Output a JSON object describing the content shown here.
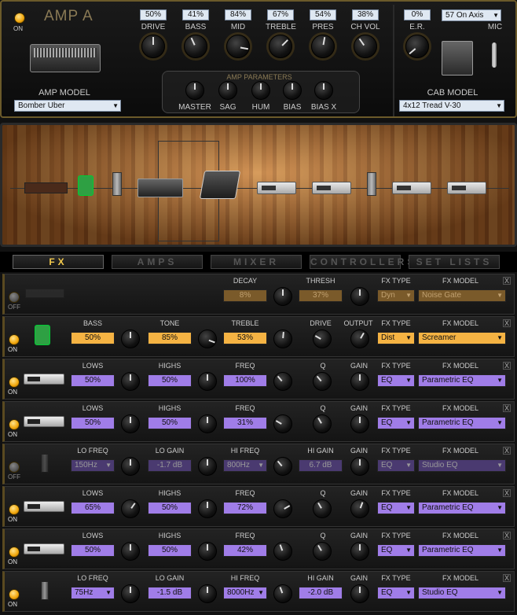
{
  "amp": {
    "title": "AMP A",
    "power_label": "ON",
    "knobs": [
      {
        "label": "DRIVE",
        "value": "50%"
      },
      {
        "label": "BASS",
        "value": "41%"
      },
      {
        "label": "MID",
        "value": "84%"
      },
      {
        "label": "TREBLE",
        "value": "67%"
      },
      {
        "label": "PRES",
        "value": "54%"
      },
      {
        "label": "CH VOL",
        "value": "38%"
      }
    ],
    "er": {
      "label": "E.R.",
      "value": "0%"
    },
    "mic": {
      "label": "MIC",
      "value": "57 On Axis"
    },
    "amp_model_label": "AMP MODEL",
    "amp_model": "Bomber Uber",
    "cab_model_label": "CAB MODEL",
    "cab_model": "4x12 Tread V-30",
    "params_title": "AMP PARAMETERS",
    "params": [
      "MASTER",
      "SAG",
      "HUM",
      "BIAS",
      "BIAS X"
    ]
  },
  "tabs": [
    "FX",
    "AMPS",
    "MIXER",
    "CONTROLLERS",
    "SET LISTS"
  ],
  "fx_rows": [
    {
      "power": "OFF",
      "icon": "noise-gate-icon",
      "params": [
        {
          "label": "DECAY",
          "value": "8%"
        },
        {
          "label": "THRESH",
          "value": "37%"
        }
      ],
      "fx_type_label": "FX TYPE",
      "fx_type": "Dyn",
      "fx_model_label": "FX MODEL",
      "fx_model": "Noise Gate"
    },
    {
      "power": "ON",
      "icon": "screamer-pedal-icon",
      "params": [
        {
          "label": "BASS",
          "value": "50%"
        },
        {
          "label": "TONE",
          "value": "85%"
        },
        {
          "label": "TREBLE",
          "value": "53%"
        }
      ],
      "drive_label": "DRIVE",
      "output_label": "OUTPUT",
      "fx_type_label": "FX TYPE",
      "fx_type": "Dist",
      "fx_model_label": "FX MODEL",
      "fx_model": "Screamer"
    },
    {
      "power": "ON",
      "icon": "parametric-eq-icon",
      "params": [
        {
          "label": "LOWS",
          "value": "50%"
        },
        {
          "label": "HIGHS",
          "value": "50%"
        },
        {
          "label": "FREQ",
          "value": "100%"
        }
      ],
      "q_label": "Q",
      "gain_label": "GAIN",
      "fx_type_label": "FX TYPE",
      "fx_type": "EQ",
      "fx_model_label": "FX MODEL",
      "fx_model": "Parametric EQ"
    },
    {
      "power": "ON",
      "icon": "parametric-eq-icon",
      "params": [
        {
          "label": "LOWS",
          "value": "50%"
        },
        {
          "label": "HIGHS",
          "value": "50%"
        },
        {
          "label": "FREQ",
          "value": "31%"
        }
      ],
      "q_label": "Q",
      "gain_label": "GAIN",
      "fx_type_label": "FX TYPE",
      "fx_type": "EQ",
      "fx_model_label": "FX MODEL",
      "fx_model": "Parametric EQ"
    },
    {
      "power": "OFF",
      "icon": "studio-eq-icon",
      "params": [
        {
          "label": "LO FREQ",
          "value": "150Hz"
        },
        {
          "label": "LO GAIN",
          "value": "-1.7 dB"
        },
        {
          "label": "HI FREQ",
          "value": "800Hz"
        },
        {
          "label": "HI GAIN",
          "value": "6.7 dB"
        }
      ],
      "gain_label": "GAIN",
      "fx_type_label": "FX TYPE",
      "fx_type": "EQ",
      "fx_model_label": "FX MODEL",
      "fx_model": "Studio EQ"
    },
    {
      "power": "ON",
      "icon": "parametric-eq-icon",
      "params": [
        {
          "label": "LOWS",
          "value": "65%"
        },
        {
          "label": "HIGHS",
          "value": "50%"
        },
        {
          "label": "FREQ",
          "value": "72%"
        }
      ],
      "q_label": "Q",
      "gain_label": "GAIN",
      "fx_type_label": "FX TYPE",
      "fx_type": "EQ",
      "fx_model_label": "FX MODEL",
      "fx_model": "Parametric EQ"
    },
    {
      "power": "ON",
      "icon": "parametric-eq-icon",
      "params": [
        {
          "label": "LOWS",
          "value": "50%"
        },
        {
          "label": "HIGHS",
          "value": "50%"
        },
        {
          "label": "FREQ",
          "value": "42%"
        }
      ],
      "q_label": "Q",
      "gain_label": "GAIN",
      "fx_type_label": "FX TYPE",
      "fx_type": "EQ",
      "fx_model_label": "FX MODEL",
      "fx_model": "Parametric EQ"
    },
    {
      "power": "ON",
      "icon": "studio-eq-icon",
      "params": [
        {
          "label": "LO FREQ",
          "value": "75Hz"
        },
        {
          "label": "LO GAIN",
          "value": "-1.5 dB"
        },
        {
          "label": "HI FREQ",
          "value": "8000Hz"
        },
        {
          "label": "HI GAIN",
          "value": "-2.0 dB"
        }
      ],
      "gain_label": "GAIN",
      "fx_type_label": "FX TYPE",
      "fx_type": "EQ",
      "fx_model_label": "FX MODEL",
      "fx_model": "Studio EQ"
    }
  ],
  "close_glyph": "X"
}
